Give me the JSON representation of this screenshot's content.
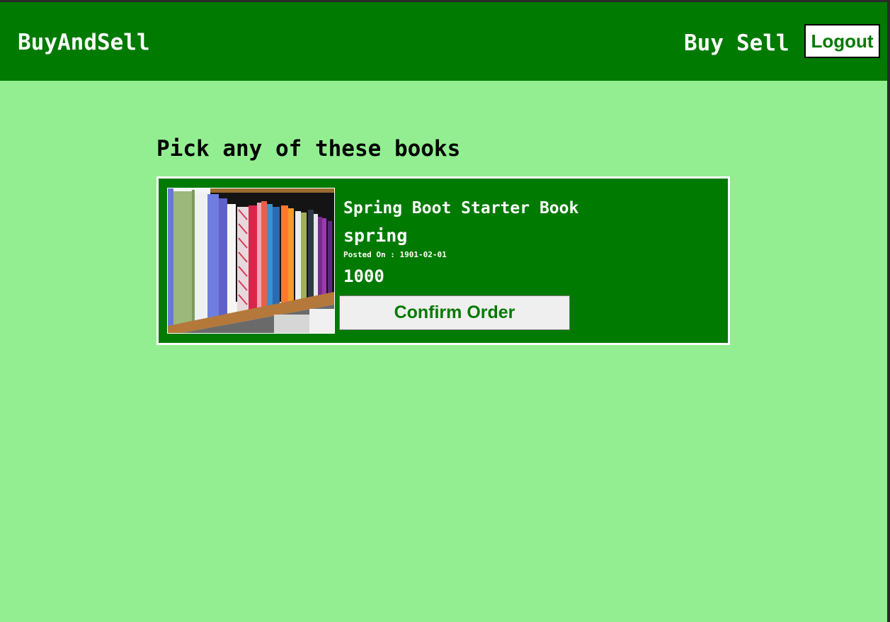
{
  "navbar": {
    "brand": "BuyAndSell",
    "links": [
      {
        "label": "Buy"
      },
      {
        "label": "Sell"
      }
    ],
    "logout_label": "Logout"
  },
  "main": {
    "heading": "Pick any of these books",
    "books": [
      {
        "title": "Spring Boot Starter Book",
        "category": "spring",
        "posted_on": "Posted On : 1901-02-01",
        "price": "1000",
        "image_icon": "bookshelf-image",
        "confirm_label": "Confirm Order"
      }
    ]
  },
  "colors": {
    "navbar_bg": "#007a00",
    "page_bg": "#93ee91",
    "card_bg": "#007a00",
    "accent_text": "#007a00"
  }
}
